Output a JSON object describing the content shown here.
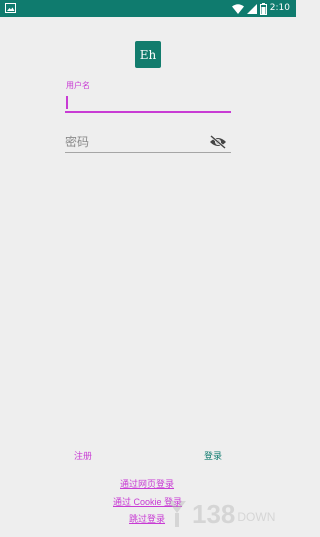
{
  "status_bar": {
    "time": "2:10",
    "background_color": "#0f7b6e",
    "left_icon": "image-notification-icon",
    "right_icons": [
      "wifi-icon",
      "cell-signal-icon",
      "battery-icon"
    ]
  },
  "app": {
    "logo_text": "Eh",
    "logo_color": "#127c6d"
  },
  "form": {
    "username_label": "用户名",
    "username_value": "",
    "password_placeholder": "密码",
    "password_toggle_icon": "eye-off-icon",
    "accent_color": "#c83bd4"
  },
  "actions": {
    "register_label": "注册",
    "login_label": "登录",
    "web_login_label": "通过网页登录",
    "cookie_login_label": "通过 Cookie 登录",
    "skip_login_label": "跳过登录"
  },
  "watermark": {
    "number": "138",
    "word": "DOWN"
  }
}
